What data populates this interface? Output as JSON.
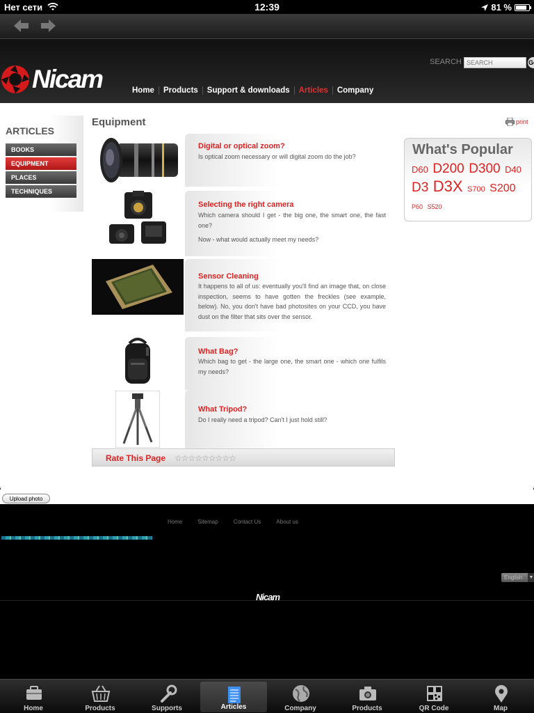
{
  "status": {
    "carrier": "Нет сети",
    "time": "12:39",
    "battery": "81 %",
    "battery_level": 0.81
  },
  "header": {
    "logo": "Nicam",
    "search_label": "SEARCH",
    "search_placeholder": "SEARCH",
    "search_go": "Go",
    "nav": [
      "Home",
      "Products",
      "Support & downloads",
      "Articles",
      "Company"
    ],
    "active_nav": "Articles"
  },
  "sidebar": {
    "title": "ARTICLES",
    "items": [
      "BOOKS",
      "EQUIPMENT",
      "PLACES",
      "TECHNIQUES"
    ],
    "active": "EQUIPMENT"
  },
  "main": {
    "title": "Equipment",
    "print": "print",
    "articles": [
      {
        "title": "Digital or optical zoom?",
        "desc": "Is optical zoom necessary or will digital zoom do the job?",
        "image": "lens"
      },
      {
        "title": "Selecting the right camera",
        "desc": "Which camera should I get - the big one, the smart one, the fast one?",
        "desc2": "Now - what would actually meet my needs?",
        "image": "cameras"
      },
      {
        "title": "Sensor Cleaning",
        "desc": "It happens to all of us: eventually you'll find an image that, on close inspection, seems to have gotten the freckles (see example, below). No, you don't have bad photosites on your CCD, you have dust on the filter that sits over the sensor.",
        "image": "sensor"
      },
      {
        "title": "What Bag?",
        "desc": "Which bag to get - the large one, the smart one - which one fulfils my needs?",
        "image": "backpack"
      },
      {
        "title": "What Tripod?",
        "desc": "Do I really need a tripod? Can't I just hold still?",
        "image": "tripod"
      }
    ],
    "rate_label": "Rate This Page",
    "rate_stars": "☆☆☆☆☆☆☆☆☆"
  },
  "popular": {
    "title": "What's Popular",
    "tags": [
      {
        "label": "D60",
        "size": "m"
      },
      {
        "label": "D200",
        "size": "l"
      },
      {
        "label": "D300",
        "size": "l"
      },
      {
        "label": "D40",
        "size": "m"
      },
      {
        "label": "D3",
        "size": "l"
      },
      {
        "label": "D3X",
        "size": "xl"
      },
      {
        "label": "S700",
        "size": "s"
      },
      {
        "label": "S200",
        "size": "m2"
      },
      {
        "label": "P60",
        "size": "xs"
      },
      {
        "label": "S520",
        "size": "xs"
      }
    ]
  },
  "upload_label": "Upload photo",
  "footer": {
    "links": [
      "Home",
      "Sitemap",
      "Contact Us",
      "About us"
    ],
    "language": "English",
    "logo": "Nicam"
  },
  "tabbar": {
    "items": [
      {
        "label": "Home",
        "icon": "briefcase-icon"
      },
      {
        "label": "Products",
        "icon": "basket-icon"
      },
      {
        "label": "Supports",
        "icon": "wrench-icon"
      },
      {
        "label": "Articles",
        "icon": "document-icon"
      },
      {
        "label": "Company",
        "icon": "globe-icon"
      },
      {
        "label": "Products",
        "icon": "camera-icon"
      },
      {
        "label": "QR Code",
        "icon": "qr-icon"
      },
      {
        "label": "Map",
        "icon": "map-pin-icon"
      }
    ],
    "active": 3
  }
}
